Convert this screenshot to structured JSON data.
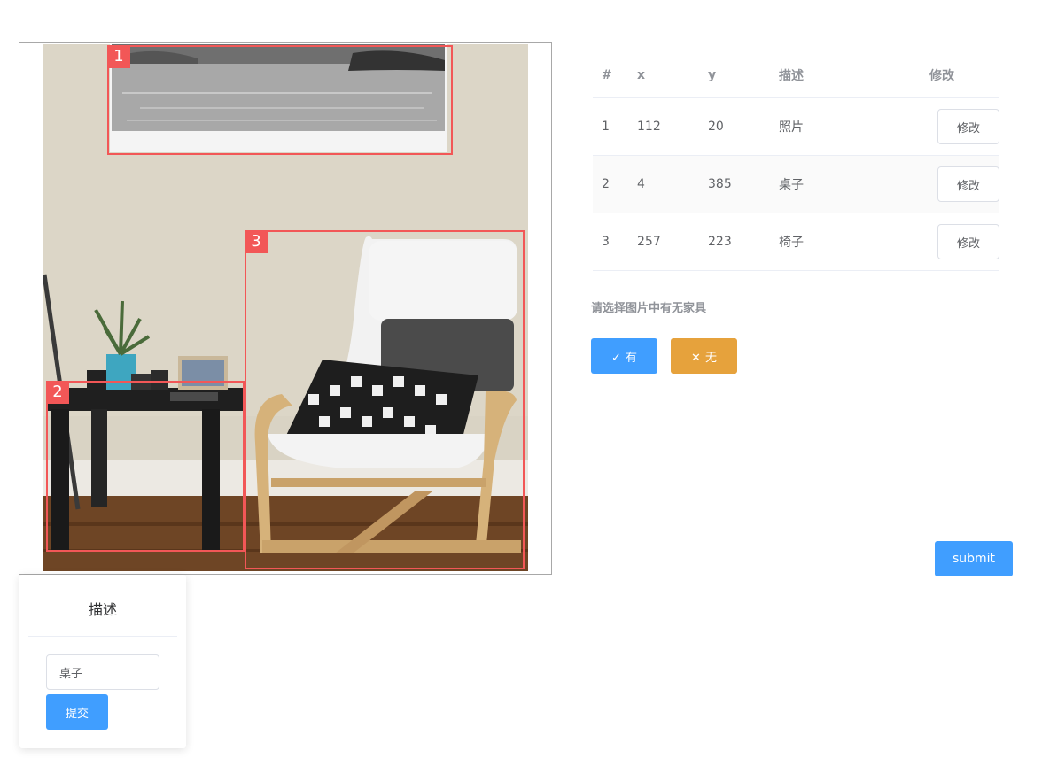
{
  "annotations": [
    {
      "index": "1",
      "x": "112",
      "y": "20",
      "desc": "照片"
    },
    {
      "index": "2",
      "x": "4",
      "y": "385",
      "desc": "桌子"
    },
    {
      "index": "3",
      "x": "257",
      "y": "223",
      "desc": "椅子"
    }
  ],
  "table": {
    "headers": {
      "index": "#",
      "x": "x",
      "y": "y",
      "desc": "描述",
      "action": "修改"
    },
    "edit_label": "修改"
  },
  "editor": {
    "title": "描述",
    "input_value": "桌子",
    "submit_label": "提交"
  },
  "question": "请选择图片中有无家具",
  "answers": {
    "yes_icon": "✓",
    "yes_label": "有",
    "no_icon": "✕",
    "no_label": "无"
  },
  "submit_label": "submit",
  "colors": {
    "box": "#f25757",
    "primary": "#409eff",
    "warning": "#e6a23c"
  }
}
